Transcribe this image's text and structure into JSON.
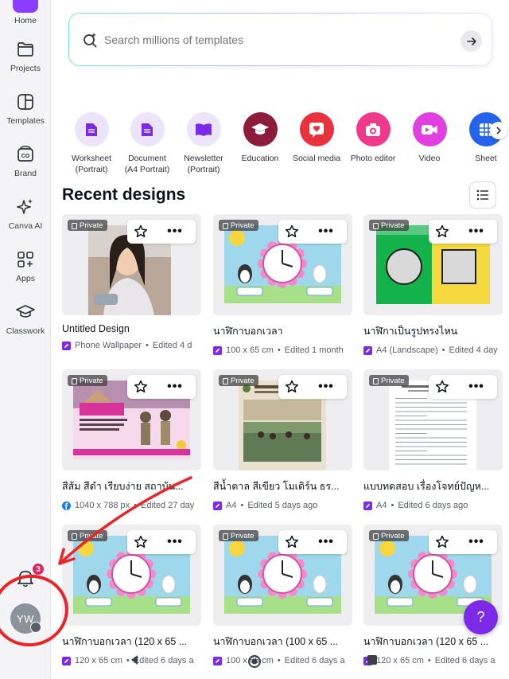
{
  "sidebar": {
    "items": [
      {
        "label": "Home",
        "icon": "home-icon"
      },
      {
        "label": "Projects",
        "icon": "folder-icon"
      },
      {
        "label": "Templates",
        "icon": "templates-icon"
      },
      {
        "label": "Brand",
        "icon": "brand-icon"
      },
      {
        "label": "Canva AI",
        "icon": "sparkle-icon"
      },
      {
        "label": "Apps",
        "icon": "apps-icon"
      },
      {
        "label": "Classwork",
        "icon": "graduation-cap-icon"
      }
    ],
    "notifications_count": "3",
    "avatar_initials": "YW"
  },
  "search": {
    "placeholder": "Search millions of templates"
  },
  "categories": [
    {
      "label": "Worksheet\n(Portrait)",
      "color": "#ece4fb",
      "icon": "document-icon",
      "icon_color": "#7d2ae8"
    },
    {
      "label": "Document\n(A4 Portrait)",
      "color": "#ece4fb",
      "icon": "document-icon",
      "icon_color": "#7d2ae8"
    },
    {
      "label": "Newsletter\n(Portrait)",
      "color": "#ece4fb",
      "icon": "book-icon",
      "icon_color": "#7d2ae8"
    },
    {
      "label": "Education",
      "color": "#8b1d3b",
      "icon": "graduation-cap-icon",
      "icon_color": "#ffffff"
    },
    {
      "label": "Social media",
      "color": "#e8333f",
      "icon": "heart-chat-icon",
      "icon_color": "#ffffff"
    },
    {
      "label": "Photo editor",
      "color": "#ef3a8c",
      "icon": "camera-icon",
      "icon_color": "#ffffff"
    },
    {
      "label": "Video",
      "color": "#e23fe1",
      "icon": "video-icon",
      "icon_color": "#ffffff"
    },
    {
      "label": "Sheet",
      "color": "#2563eb",
      "icon": "sheet-icon",
      "icon_color": "#ffffff"
    }
  ],
  "recent": {
    "title": "Recent designs",
    "private_label": "Private",
    "more_label": "•••",
    "cards": [
      {
        "title": "Untitled Design",
        "meta_type": "Phone Wallpaper",
        "meta_edit": "Edited 4 d",
        "meta_icon_color": "#7d2ae8",
        "thumb": "photo"
      },
      {
        "title": "นาฬิกาบอกเวลา",
        "meta_type": "100 x 65 cm",
        "meta_edit": "Edited 1 month",
        "meta_icon_color": "#7d2ae8",
        "thumb": "clock"
      },
      {
        "title": "นาฬิกาเป็นรูปทรงไหน",
        "meta_type": "A4 (Landscape)",
        "meta_edit": "Edited 4 day",
        "meta_icon_color": "#7d2ae8",
        "thumb": "shapes"
      },
      {
        "title": "สีส้ม สีดำ เรียบง่าย สถาบัน...",
        "meta_type": "1040 x 788 px",
        "meta_edit": "Edited 27 day",
        "meta_icon_color": "#1877f2",
        "thumb": "poster"
      },
      {
        "title": "สีน้ำตาล สีเขียว โมเดิร์น ธร...",
        "meta_type": "A4",
        "meta_edit": "Edited 5 days ago",
        "meta_icon_color": "#7d2ae8",
        "thumb": "report"
      },
      {
        "title": "แบบทดสอบ เรื่องโจทย์ปัญห...",
        "meta_type": "A4",
        "meta_edit": "Edited 6 days ago",
        "meta_icon_color": "#7d2ae8",
        "thumb": "worksheet"
      },
      {
        "title": "นาฬิกาบอกเวลา (120 x 65 ...",
        "meta_type": "120 x 65 cm",
        "meta_edit": "Edited 6 days a",
        "meta_icon_color": "#7d2ae8",
        "thumb": "clock"
      },
      {
        "title": "นาฬิกาบอกเวลา (100 x 65 ...",
        "meta_type": "100 x 65 cm",
        "meta_edit": "Edited 6 days a",
        "meta_icon_color": "#7d2ae8",
        "thumb": "clock"
      },
      {
        "title": "นาฬิกาบอกเวลา (120 x 65 ...",
        "meta_type": "120 x 65 cm",
        "meta_edit": "Edited 6 days a",
        "meta_icon_color": "#7d2ae8",
        "thumb": "clock"
      }
    ]
  },
  "help_label": "?",
  "accent": "#8b3dff",
  "annotation_color": "#e8262a"
}
